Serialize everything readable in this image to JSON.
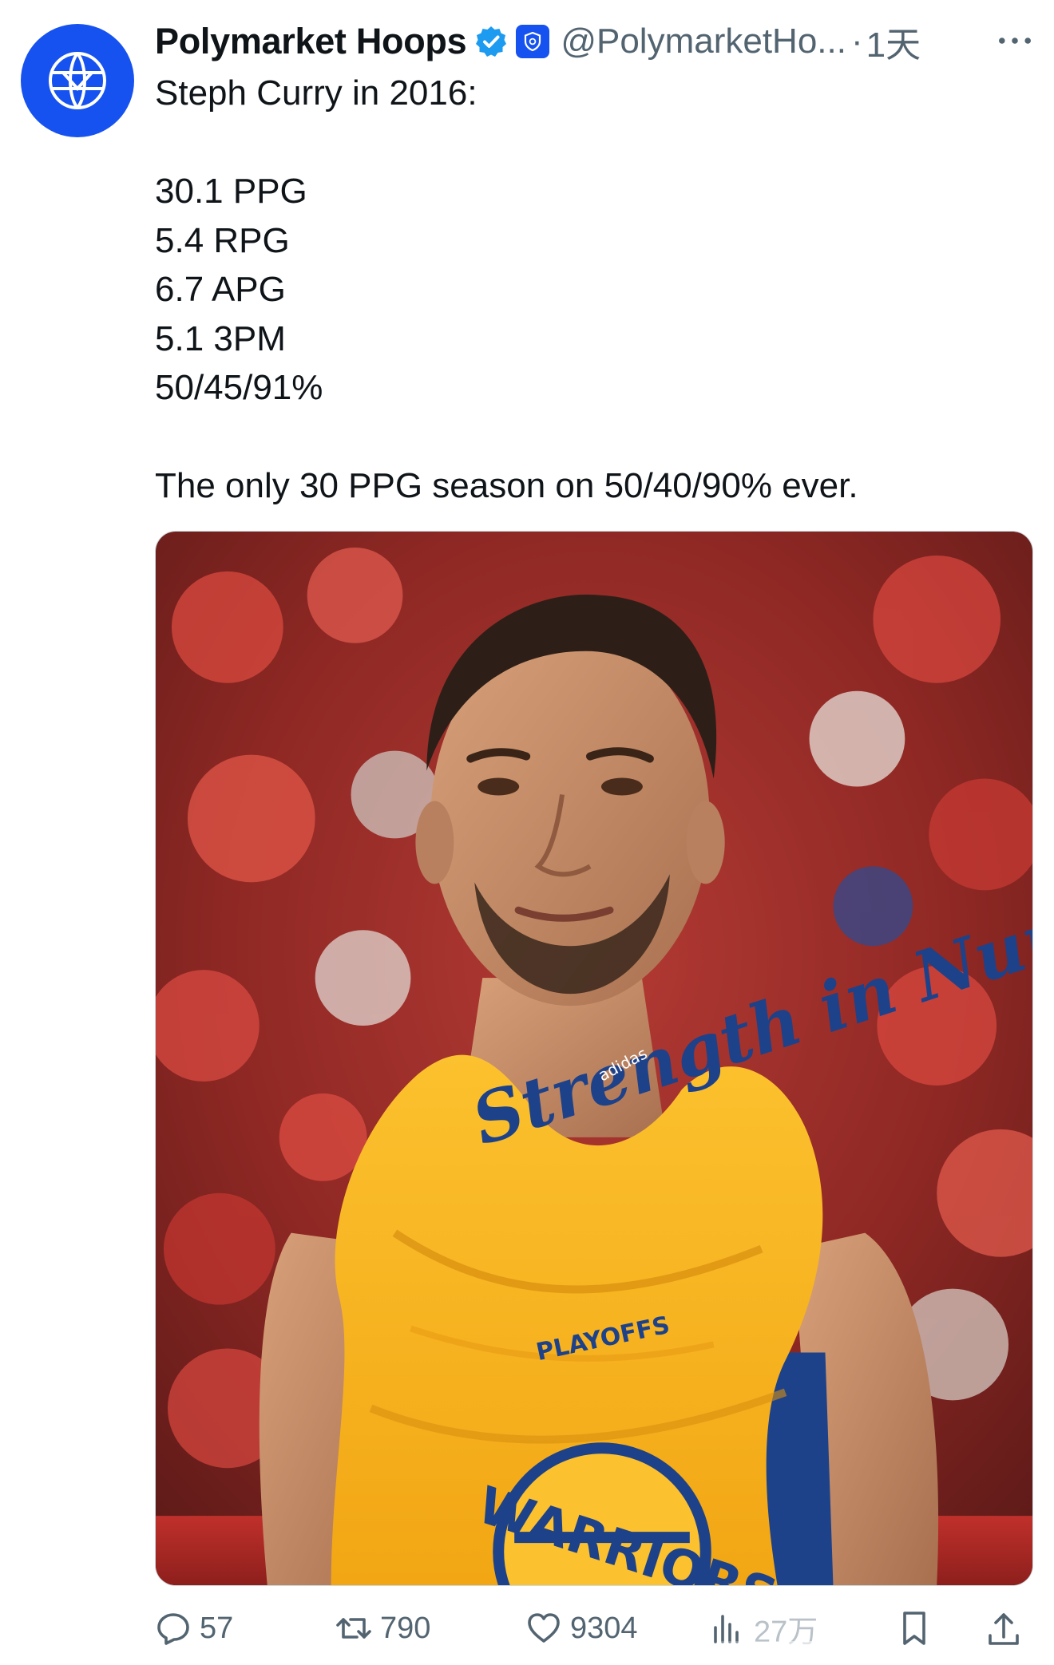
{
  "author": {
    "display_name": "Polymarket Hoops",
    "handle": "@PolymarketHo...",
    "separator": "·",
    "time": "1天",
    "avatar_icon": "basketball-logo-icon",
    "verified_icon": "verified-badge-icon",
    "affiliate_icon": "affiliate-badge-icon",
    "more_icon": "more-dots-icon"
  },
  "tweet": {
    "lines": [
      "Steph Curry in 2016:",
      "",
      "30.1 PPG",
      "5.4 RPG",
      "6.7 APG",
      "5.1 3PM",
      "50/45/91%",
      "",
      "The only 30 PPG season on 50/40/90% ever."
    ]
  },
  "media": {
    "type": "photo",
    "shirt_text": "Strength in Numbers",
    "shirt_subtext": "PLAYOFFS",
    "jersey_text": "WARRIORS",
    "brand_text": "adidas"
  },
  "actions": {
    "reply": {
      "icon": "reply-icon",
      "count": "57"
    },
    "retweet": {
      "icon": "retweet-icon",
      "count": "790"
    },
    "like": {
      "icon": "heart-icon",
      "count": "9304"
    },
    "views": {
      "icon": "views-chart-icon",
      "count": "27万"
    },
    "bookmark": {
      "icon": "bookmark-icon"
    },
    "share": {
      "icon": "share-icon"
    }
  },
  "colors": {
    "brand_blue": "#1652f0",
    "verified_blue": "#1d9bf0",
    "text_primary": "#0f1419",
    "text_secondary": "#536471",
    "shirt_gold": "#fdb927",
    "warriors_blue": "#1d428a"
  }
}
